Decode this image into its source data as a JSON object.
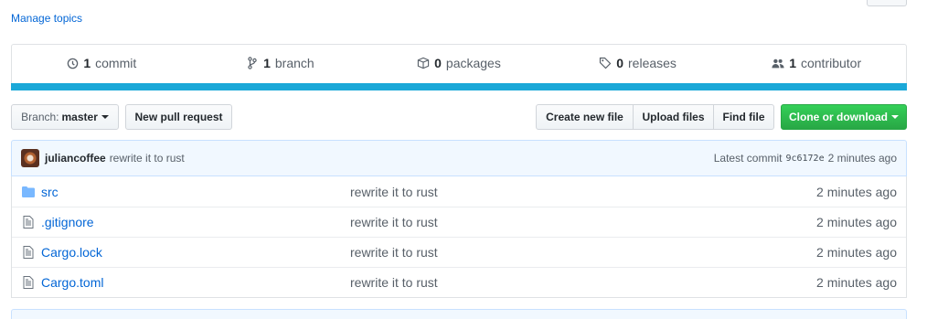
{
  "topics": {
    "manage_label": "Manage topics"
  },
  "summary": {
    "commits": {
      "count": "1",
      "label": "commit",
      "icon": "history-icon"
    },
    "branches": {
      "count": "1",
      "label": "branch",
      "icon": "git-branch-icon"
    },
    "packages": {
      "count": "0",
      "label": "packages",
      "icon": "package-icon"
    },
    "releases": {
      "count": "0",
      "label": "releases",
      "icon": "tag-icon"
    },
    "contributors": {
      "count": "1",
      "label": "contributor",
      "icon": "people-icon"
    },
    "language_color": "#1ba8d8"
  },
  "file_nav": {
    "branch_prefix": "Branch:",
    "branch_name": "master",
    "new_pr": "New pull request",
    "create_file": "Create new file",
    "upload_files": "Upload files",
    "find_file": "Find file",
    "clone": "Clone or download"
  },
  "commit": {
    "author": "juliancoffee",
    "message": "rewrite it to rust",
    "latest_label": "Latest commit",
    "sha": "9c6172e",
    "age": "2 minutes ago"
  },
  "files": [
    {
      "name": "src",
      "type": "folder",
      "message": "rewrite it to rust",
      "age": "2 minutes ago"
    },
    {
      "name": ".gitignore",
      "type": "file",
      "message": "rewrite it to rust",
      "age": "2 minutes ago"
    },
    {
      "name": "Cargo.lock",
      "type": "file",
      "message": "rewrite it to rust",
      "age": "2 minutes ago"
    },
    {
      "name": "Cargo.toml",
      "type": "file",
      "message": "rewrite it to rust",
      "age": "2 minutes ago"
    }
  ],
  "colors": {
    "link": "#0366d6",
    "green": "#28a745",
    "muted": "#586069"
  }
}
